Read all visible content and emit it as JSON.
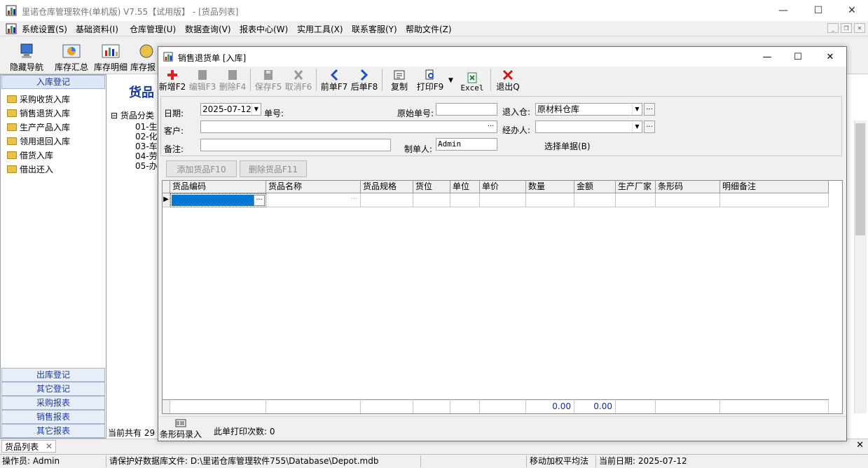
{
  "window": {
    "title": "里诺仓库管理软件(单机版) V7.55【试用版】 - [货品列表]"
  },
  "menu": [
    "系统设置(S)",
    "基础资料(I)",
    "仓库管理(U)",
    "数据查询(V)",
    "报表中心(W)",
    "实用工具(X)",
    "联系客服(Y)",
    "帮助文件(Z)"
  ],
  "toolbar": [
    "隐藏导航",
    "库存汇总",
    "库存明细",
    "库存报"
  ],
  "nav": {
    "header": "入库登记",
    "items": [
      "采购收货入库",
      "销售退货入库",
      "生产产品入库",
      "领用退回入库",
      "借货入库",
      "借出还入"
    ],
    "footer": [
      "出库登记",
      "其它登记",
      "采购报表",
      "销售报表",
      "其它报表"
    ]
  },
  "background": {
    "title": "货品",
    "tree_root": "货品分类",
    "tree_items": [
      "01-生",
      "02-化",
      "03-车",
      "04-劳",
      "05-办"
    ],
    "count_text": "当前共有 29"
  },
  "doc_tab": "货品列表",
  "status": {
    "operator": "操作员: Admin",
    "db_notice": "请保护好数据库文件: D:\\里诺仓库管理软件755\\Database\\Depot.mdb",
    "method": "移动加权平均法",
    "date": "当前日期: 2025-07-12"
  },
  "dialog": {
    "title": "销售退货单 [入库]",
    "toolbar": {
      "new": "新增F2",
      "edit": "编辑F3",
      "delete": "删除F4",
      "save": "保存F5",
      "cancel": "取消F6",
      "prev": "前单F7",
      "next": "后单F8",
      "copy": "复制",
      "print": "打印F9",
      "excel": "Excel",
      "exit": "退出Q"
    },
    "form": {
      "date_label": "日期:",
      "date_value": "2025-07-12",
      "number_label": "单号:",
      "orig_label": "原始单号:",
      "warehouse_label": "退入仓:",
      "warehouse_value": "原材料仓库",
      "customer_label": "客户:",
      "handler_label": "经办人:",
      "remark_label": "备注:",
      "maker_label": "制单人:",
      "maker_value": "Admin",
      "select_doc": "选择单据(B)"
    },
    "add_item_btn": "添加货品F10",
    "remove_item_btn": "删除货品F11",
    "grid": {
      "columns": [
        "货品编码",
        "货品名称",
        "货品规格",
        "货位",
        "单位",
        "单价",
        "数量",
        "金额",
        "生产厂家",
        "条形码",
        "明细备注"
      ],
      "totals": {
        "quantity": "0.00",
        "amount": "0.00"
      }
    },
    "barcode_entry": "条形码录入",
    "print_count_label": "此单打印次数:",
    "print_count": "0"
  }
}
